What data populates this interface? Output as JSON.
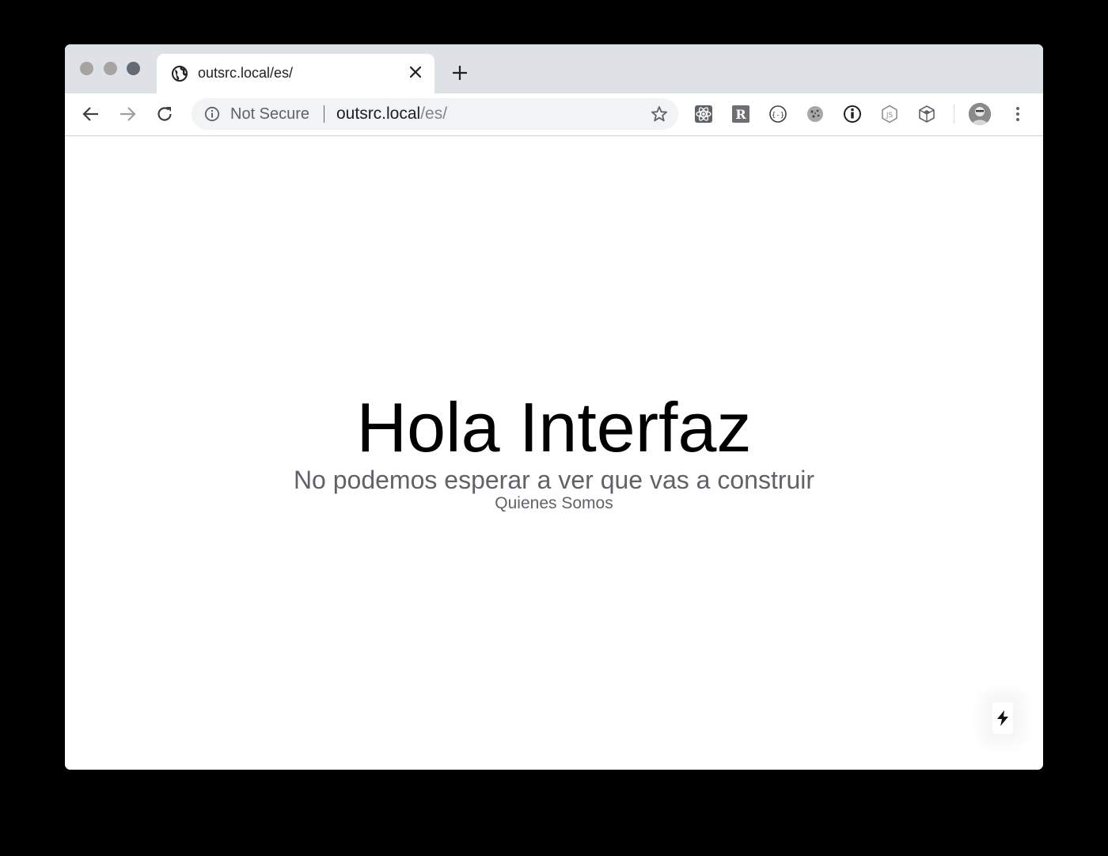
{
  "window": {
    "traffic_lights": [
      "close",
      "minimize",
      "maximize"
    ]
  },
  "tabs": [
    {
      "favicon": "globe-icon",
      "title": "outsrc.local/es/",
      "active": true
    }
  ],
  "toolbar": {
    "back_icon": "arrow-left-icon",
    "forward_icon": "arrow-right-icon",
    "reload_icon": "reload-icon",
    "security_label": "Not Secure",
    "url_host": "outsrc.local",
    "url_path": "/es/",
    "bookmark_icon": "star-icon",
    "extensions": [
      "react-devtools-icon",
      "r-extension-icon",
      "json-viewer-icon",
      "cookie-icon",
      "info-extension-icon",
      "nodejs-icon",
      "box-extension-icon"
    ],
    "profile_icon": "avatar",
    "menu_icon": "kebab-menu-icon"
  },
  "page": {
    "title": "Hola Interfaz",
    "subtitle": "No podemos esperar a ver que vas a construir",
    "link_label": "Quienes Somos"
  },
  "prerender_indicator": {
    "icon": "lightning-icon"
  },
  "colors": {
    "tabstrip": "#dee1e6",
    "omnibox": "#f1f3f4",
    "text_primary": "#202124",
    "text_secondary": "#5f6368",
    "url_path": "#80868b",
    "heading": "#000000"
  }
}
